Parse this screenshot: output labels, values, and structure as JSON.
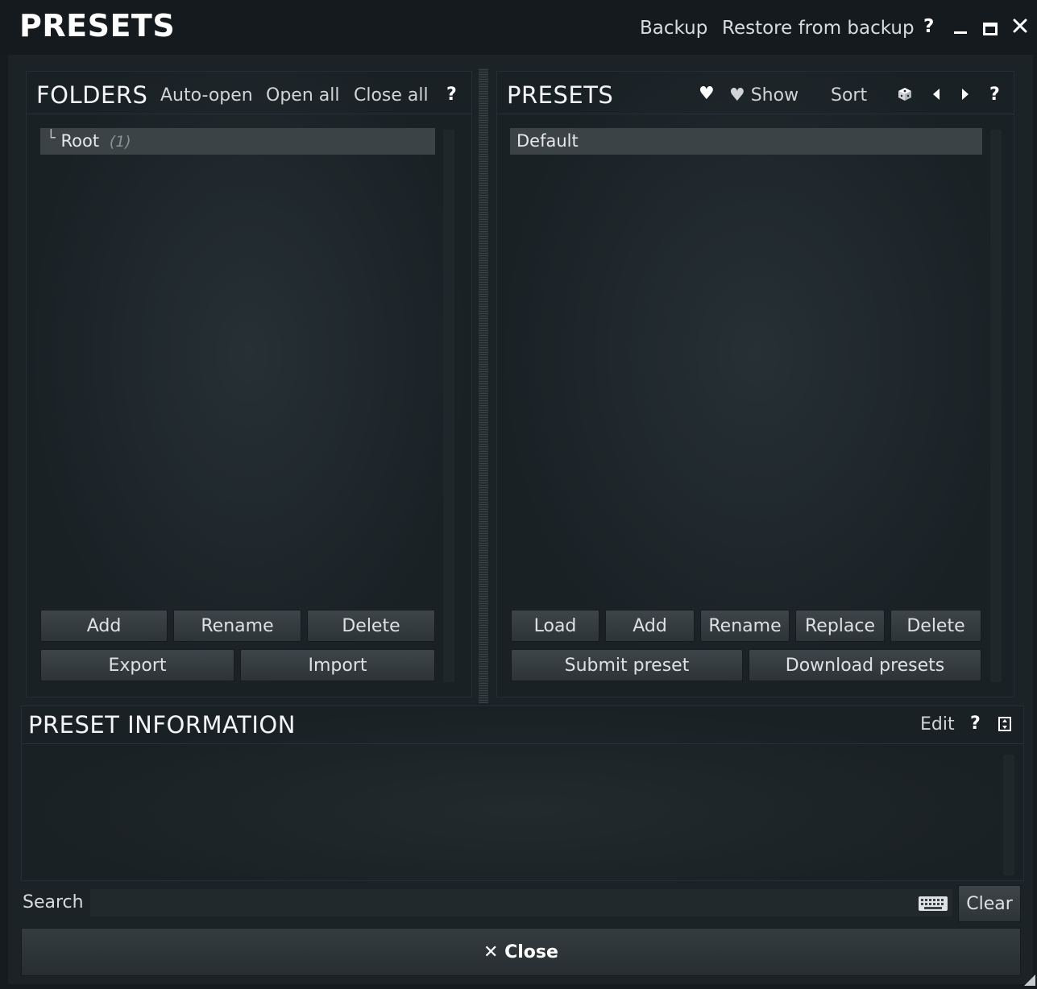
{
  "titlebar": {
    "title": "PRESETS",
    "backup": "Backup",
    "restore": "Restore from backup",
    "help": "?"
  },
  "folders": {
    "title": "FOLDERS",
    "auto_open": "Auto-open",
    "open_all": "Open all",
    "close_all": "Close all",
    "help": "?",
    "tree_prefix": "└",
    "items": [
      {
        "label": "Root",
        "count": "(1)"
      }
    ],
    "buttons": {
      "add": "Add",
      "rename": "Rename",
      "delete": "Delete",
      "export": "Export",
      "import": "Import"
    }
  },
  "presets": {
    "title": "PRESETS",
    "heart": "♥",
    "show": "♥ Show",
    "sort": "Sort",
    "help": "?",
    "items": [
      {
        "label": "Default"
      }
    ],
    "buttons": {
      "load": "Load",
      "add": "Add",
      "rename": "Rename",
      "replace": "Replace",
      "delete": "Delete",
      "submit": "Submit preset",
      "download": "Download presets"
    }
  },
  "info": {
    "title": "PRESET INFORMATION",
    "edit": "Edit",
    "help": "?"
  },
  "search": {
    "label": "Search",
    "value": "",
    "clear": "Clear"
  },
  "close_button": "✕ Close"
}
